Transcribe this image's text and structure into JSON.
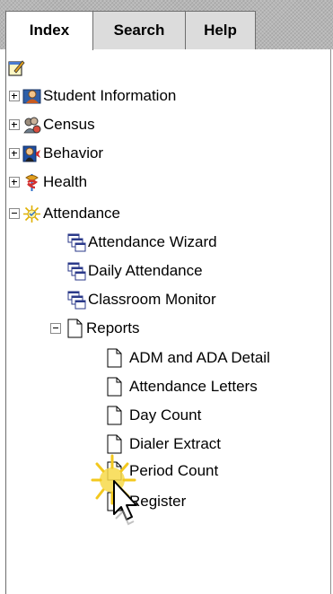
{
  "tabs": [
    {
      "label": "Index",
      "active": true
    },
    {
      "label": "Search",
      "active": false
    },
    {
      "label": "Help",
      "active": false
    }
  ],
  "toolbar": {
    "icon": "edit-note-icon"
  },
  "tree": {
    "modules": [
      {
        "label": "Student Information",
        "icon": "student-icon",
        "expanded": false
      },
      {
        "label": "Census",
        "icon": "census-icon",
        "expanded": false
      },
      {
        "label": "Behavior",
        "icon": "behavior-icon",
        "expanded": false
      },
      {
        "label": "Health",
        "icon": "health-icon",
        "expanded": false
      },
      {
        "label": "Attendance",
        "icon": "attendance-icon",
        "expanded": true
      }
    ],
    "attendance_items": [
      {
        "label": "Attendance Wizard",
        "icon": "tool-windows-icon"
      },
      {
        "label": "Daily Attendance",
        "icon": "tool-windows-icon"
      },
      {
        "label": "Classroom Monitor",
        "icon": "tool-windows-icon"
      }
    ],
    "reports": {
      "label": "Reports",
      "expanded": true,
      "items": [
        {
          "label": "ADM and ADA Detail"
        },
        {
          "label": "Attendance Letters"
        },
        {
          "label": "Day Count"
        },
        {
          "label": "Dialer Extract"
        },
        {
          "label": "Period Count"
        },
        {
          "label": "Register"
        }
      ]
    }
  },
  "colors": {
    "tab_border": "#6e6e6e",
    "tab_bg": "#dcdcdc",
    "highlight": "#f3c81e"
  }
}
